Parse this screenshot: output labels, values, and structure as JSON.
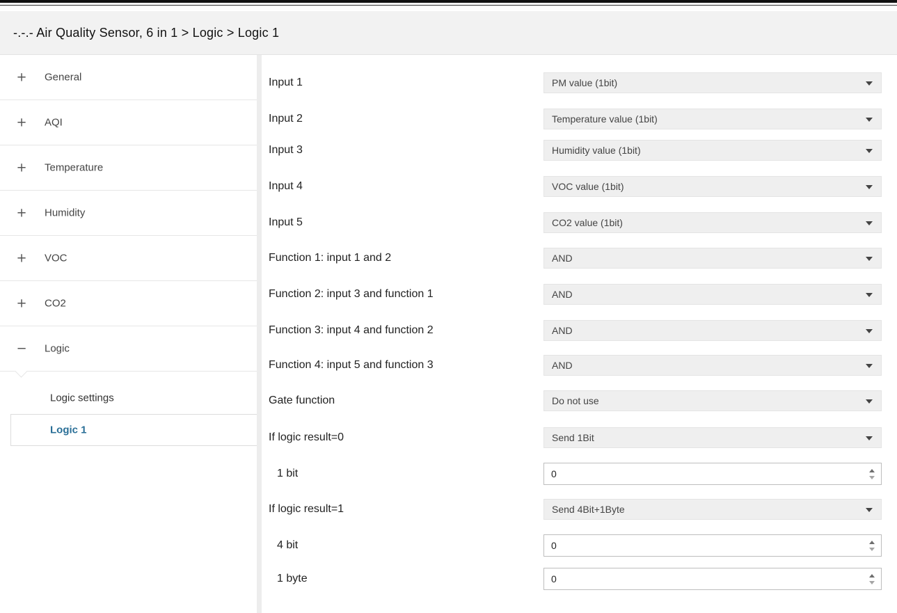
{
  "header": {
    "title": "-.-.- Air Quality Sensor, 6 in 1 > Logic > Logic 1"
  },
  "sidebar": {
    "categories": [
      {
        "sign": "+",
        "label": "General"
      },
      {
        "sign": "+",
        "label": "AQI"
      },
      {
        "sign": "+",
        "label": "Temperature"
      },
      {
        "sign": "+",
        "label": "Humidity"
      },
      {
        "sign": "+",
        "label": "VOC"
      },
      {
        "sign": "+",
        "label": "CO2"
      },
      {
        "sign": "−",
        "label": "Logic"
      }
    ],
    "subitems": [
      {
        "label": "Logic settings"
      },
      {
        "label": "Logic 1"
      }
    ]
  },
  "params": [
    {
      "label": "Input 1",
      "value": "PM value (1bit)",
      "type": "dropdown"
    },
    {
      "label": "Input 2",
      "value": "Temperature value (1bit)",
      "type": "dropdown"
    },
    {
      "label": "Input 3",
      "value": "Humidity value (1bit)",
      "type": "dropdown"
    },
    {
      "label": "Input 4",
      "value": "VOC value (1bit)",
      "type": "dropdown"
    },
    {
      "label": "Input 5",
      "value": "CO2 value (1bit)",
      "type": "dropdown"
    },
    {
      "label": "Function 1: input 1 and 2",
      "value": "AND",
      "type": "dropdown"
    },
    {
      "label": "Function 2: input 3 and function 1",
      "value": "AND",
      "type": "dropdown"
    },
    {
      "label": "Function 3: input 4 and function 2",
      "value": "AND",
      "type": "dropdown"
    },
    {
      "label": "Function 4: input 5 and function 3",
      "value": "AND",
      "type": "dropdown"
    },
    {
      "label": "Gate function",
      "value": "Do not use",
      "type": "dropdown"
    },
    {
      "label": "If logic result=0",
      "value": "Send 1Bit",
      "type": "dropdown"
    },
    {
      "label": "1 bit",
      "value": "0",
      "type": "spin"
    },
    {
      "label": "If logic result=1",
      "value": "Send 4Bit+1Byte",
      "type": "dropdown"
    },
    {
      "label": "4 bit",
      "value": "0",
      "type": "spin"
    },
    {
      "label": "1 byte",
      "value": "0",
      "type": "spin"
    }
  ],
  "colors": {
    "active_item_text": "#2a6f97",
    "titlebar_bg": "#f2f2f2",
    "dropdown_bg": "#efefef"
  },
  "icons": {
    "expand": "plus-icon",
    "collapse": "minus-icon",
    "dropdown": "caret-down-icon",
    "spinner": "spinner-arrows-icon"
  }
}
